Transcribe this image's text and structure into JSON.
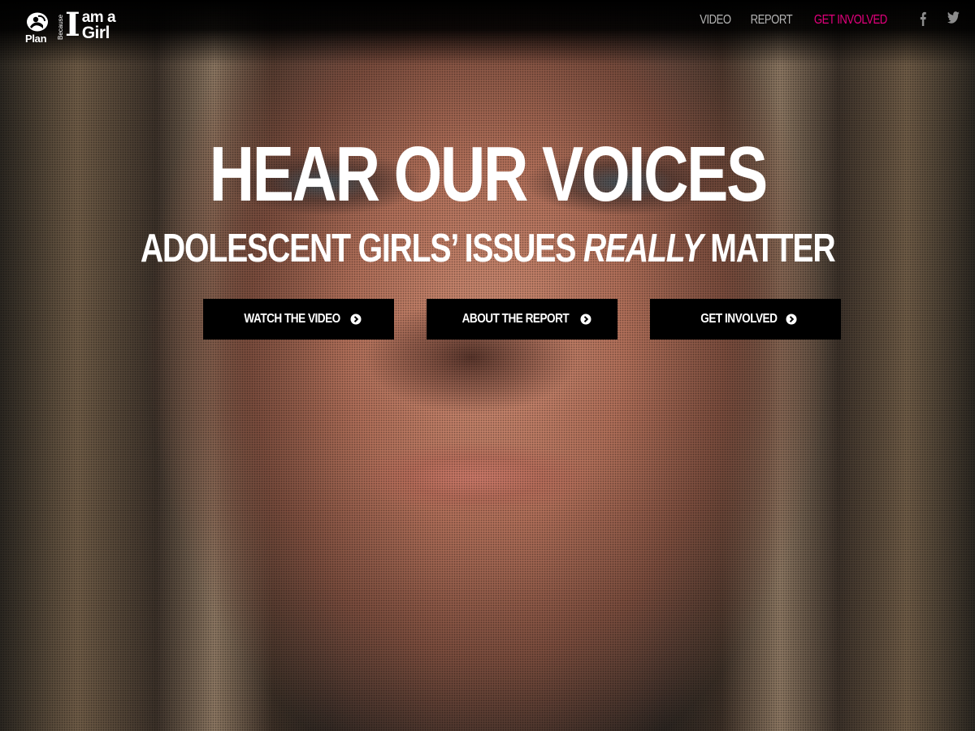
{
  "logo": {
    "plan": "Plan",
    "because": "Because",
    "i": "I",
    "am_a": "am a",
    "girl": "Girl"
  },
  "nav": {
    "items": [
      {
        "label": "VIDEO",
        "active": false
      },
      {
        "label": "REPORT",
        "active": false
      },
      {
        "label": "GET INVOLVED",
        "active": true
      }
    ],
    "social": [
      "facebook-icon",
      "twitter-icon"
    ]
  },
  "hero": {
    "title": "HEAR OUR VOICES",
    "subtitle_before": "ADOLESCENT GIRLS’ ISSUES ",
    "subtitle_emphasis": "REALLY",
    "subtitle_after": " MATTER"
  },
  "buttons": {
    "watch_video": "WATCH THE VIDEO",
    "about_report": "ABOUT THE REPORT",
    "get_involved": "GET INVOLVED",
    "icon": "circle-chevron-right-icon"
  },
  "colors": {
    "accent": "#e5007e",
    "nav_text": "#b4b4b4",
    "button_bg": "#000000",
    "text": "#ffffff"
  }
}
